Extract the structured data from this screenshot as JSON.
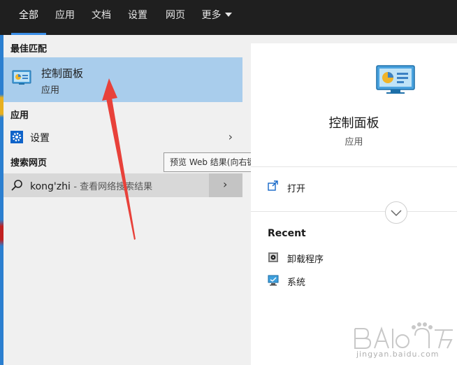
{
  "tabs": [
    {
      "label": "全部",
      "active": true
    },
    {
      "label": "应用",
      "active": false
    },
    {
      "label": "文档",
      "active": false
    },
    {
      "label": "设置",
      "active": false
    },
    {
      "label": "网页",
      "active": false
    },
    {
      "label": "更多",
      "active": false
    }
  ],
  "sections": {
    "best_match": "最佳匹配",
    "apps": "应用",
    "web": "搜索网页"
  },
  "best_match": {
    "title": "控制面板",
    "subtitle": "应用"
  },
  "apps_items": [
    {
      "label": "设置",
      "icon": "gear-icon"
    }
  ],
  "web_search": {
    "query": "kong'zhi",
    "hint": "- 查看网络搜索结果"
  },
  "tooltip": "预览 Web 结果(向右键)",
  "detail": {
    "title": "控制面板",
    "subtitle": "应用",
    "open_label": "打开",
    "recent_heading": "Recent",
    "recent_items": [
      {
        "label": "卸载程序",
        "icon": "uninstall-icon"
      },
      {
        "label": "系统",
        "icon": "system-monitor-icon"
      }
    ]
  },
  "watermark": {
    "text": "jingyan.baidu.com"
  },
  "colors": {
    "topbar": "#1f1f1f",
    "accent": "#3a8ee6",
    "selected_row": "#a9cdec",
    "annotation": "#e8413a"
  }
}
